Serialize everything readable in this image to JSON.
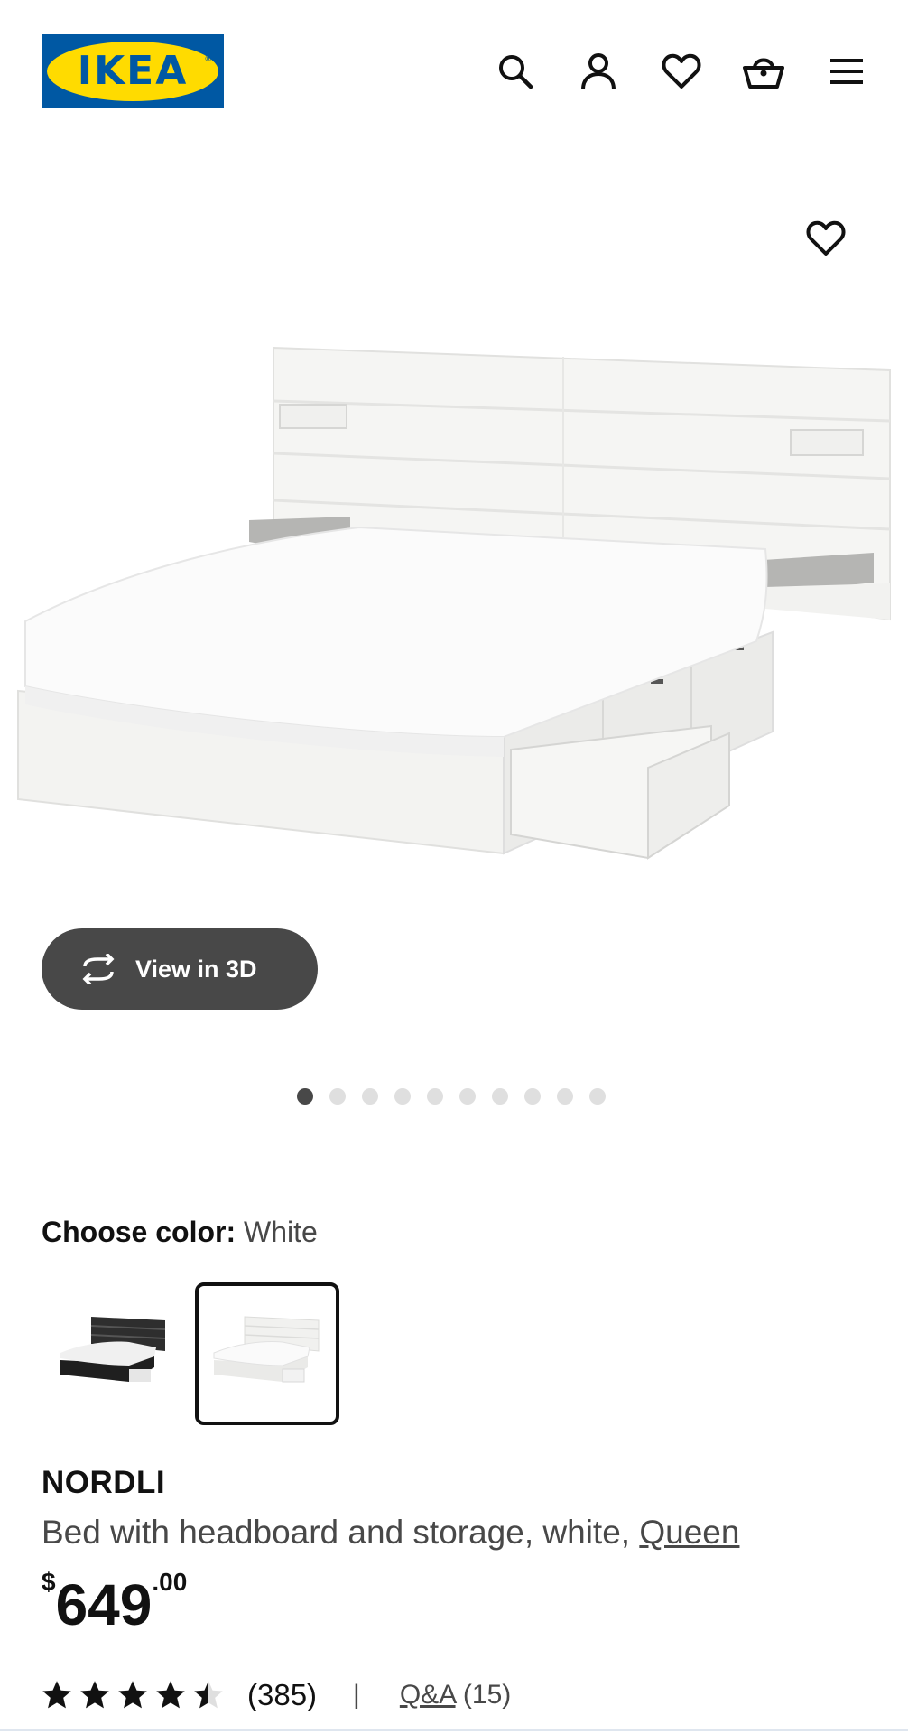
{
  "header": {
    "logo_text": "IKEA",
    "logo_reg": "®",
    "icons": [
      "search-icon",
      "user-icon",
      "heart-icon",
      "basket-icon",
      "menu-icon"
    ]
  },
  "gallery": {
    "view_3d_label": "View in 3D",
    "dots_total": 10,
    "active_dot": 1
  },
  "color_chooser": {
    "label": "Choose color:",
    "selected_value": "White",
    "swatches": [
      "black-brown",
      "white"
    ],
    "selected_index": 1
  },
  "product": {
    "name": "NORDLI",
    "description": "Bed with headboard and storage, white,",
    "size_link": "Queen",
    "price_currency": "$",
    "price_integer": "649",
    "price_decimal": ".00",
    "rating": 4.5,
    "review_count": "(385)",
    "separator": "|",
    "qa_label": "Q&A",
    "qa_count": "(15)"
  },
  "colors": {
    "brand_blue": "#0058a3",
    "brand_yellow": "#ffdb00",
    "dark_button": "#484848",
    "text": "#111111"
  }
}
